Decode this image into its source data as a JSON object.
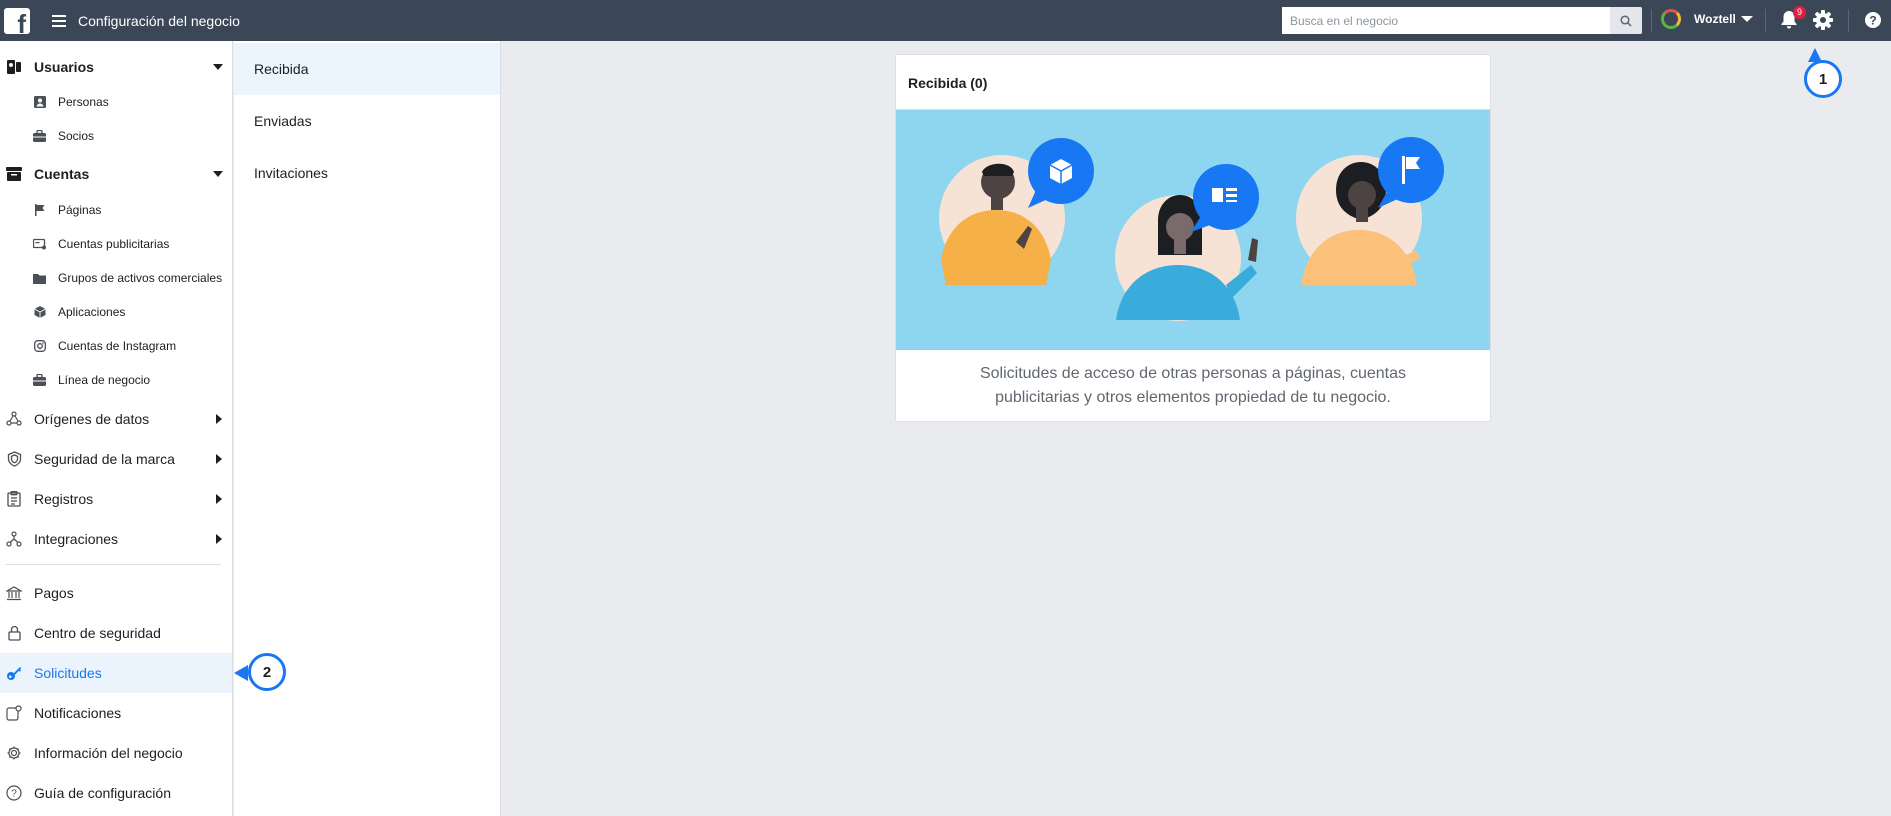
{
  "topbar": {
    "logo": "f",
    "title": "Configuración del negocio",
    "search_placeholder": "Busca en el negocio",
    "business_name": "Woztell",
    "notification_count": "9"
  },
  "sidebar": {
    "users_section": "Usuarios",
    "users_items": [
      "Personas",
      "Socios"
    ],
    "accounts_section": "Cuentas",
    "accounts_items": [
      "Páginas",
      "Cuentas publicitarias",
      "Grupos de activos comerciales",
      "Aplicaciones",
      "Cuentas de Instagram",
      "Línea de negocio"
    ],
    "expandable": [
      "Orígenes de datos",
      "Seguridad de la marca",
      "Registros",
      "Integraciones"
    ],
    "bottom_items": [
      "Pagos",
      "Centro de seguridad",
      "Solicitudes",
      "Notificaciones",
      "Información del negocio",
      "Guía de configuración"
    ],
    "active_item": "Solicitudes"
  },
  "subnav": {
    "items": [
      "Recibida",
      "Enviadas",
      "Invitaciones"
    ],
    "active_item": "Recibida"
  },
  "card": {
    "title": "Recibida (0)",
    "description": "Solicitudes de acceso de otras personas a páginas, cuentas publicitarias y otros elementos propiedad de tu negocio."
  },
  "callouts": [
    "1",
    "2"
  ],
  "colors": {
    "topbar": "#3b4656",
    "accent": "#1877f2",
    "illustration_bg": "#8ed5ef",
    "active_row": "#ebf3fd"
  }
}
